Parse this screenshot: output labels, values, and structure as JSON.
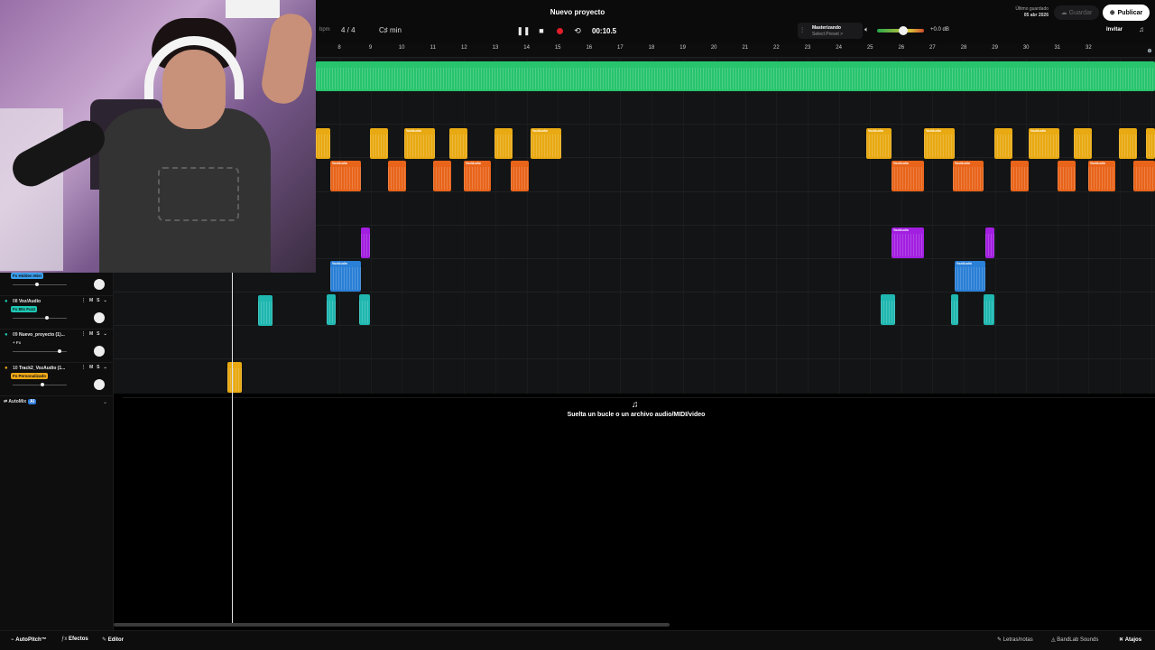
{
  "header": {
    "project_title": "Nuevo proyecto",
    "bpm_label": "bpm",
    "time_signature": "4 / 4",
    "key": "C♯ min",
    "time": "00:10.5",
    "mastering_label": "Masterizando",
    "mastering_preset": "Select Preset >",
    "volume_db": "+0.0 dB",
    "volume_level": 0.55,
    "last_saved_label": "Último guardado",
    "last_saved_date": "05 abr 2026",
    "save_label": "Guardar",
    "publish_label": "Publicar",
    "invite_label": "Invitar"
  },
  "ruler": {
    "bars": [
      "8",
      "9",
      "10",
      "11",
      "12",
      "13",
      "14",
      "15",
      "16",
      "17",
      "18",
      "19",
      "20",
      "21",
      "22",
      "23",
      "24",
      "25",
      "26",
      "27",
      "28",
      "29",
      "30",
      "31",
      "32"
    ]
  },
  "tracks": [
    {
      "number": "",
      "name": "",
      "fx": "Fx Hidden Mist",
      "fx_color": "#3aa0f0",
      "volume": 0.45
    },
    {
      "number": "08",
      "name": "Voz/Audio",
      "fx": "Fx 80s Fuzz",
      "fx_color": "#1ec8b4",
      "volume": 0.65
    },
    {
      "number": "09",
      "name": "Nuevo_proyecto (1)...",
      "fx": "+ Fx",
      "fx_color": "",
      "volume": 0.9
    },
    {
      "number": "10",
      "name": "Track2_VozAudio (1...",
      "fx": "Fx Personalizado",
      "fx_color": "#f0a818",
      "volume": 0.55
    }
  ],
  "track_buttons": {
    "mute": "M",
    "solo": "S"
  },
  "automix": {
    "label": "AutoMix",
    "badge": "AI"
  },
  "clip_label": "Voz/Audio",
  "drop_zone_text": "Suelta un bucle o un archivo audio/MIDI/video",
  "bottom_bar": {
    "autopitch": "AutoPitch™",
    "effects": "Efectos",
    "editor": "Editor",
    "lyrics": "Letras/notas",
    "sounds": "BandLab Sounds",
    "shortcuts": "Atajos"
  },
  "colors": {
    "green": "#27c46d",
    "yellow": "#e8a912",
    "orange": "#e8641a",
    "purple": "#a21ee0",
    "blue": "#2a7fd6",
    "teal": "#1fb7b0",
    "record": "#e01f2a"
  }
}
